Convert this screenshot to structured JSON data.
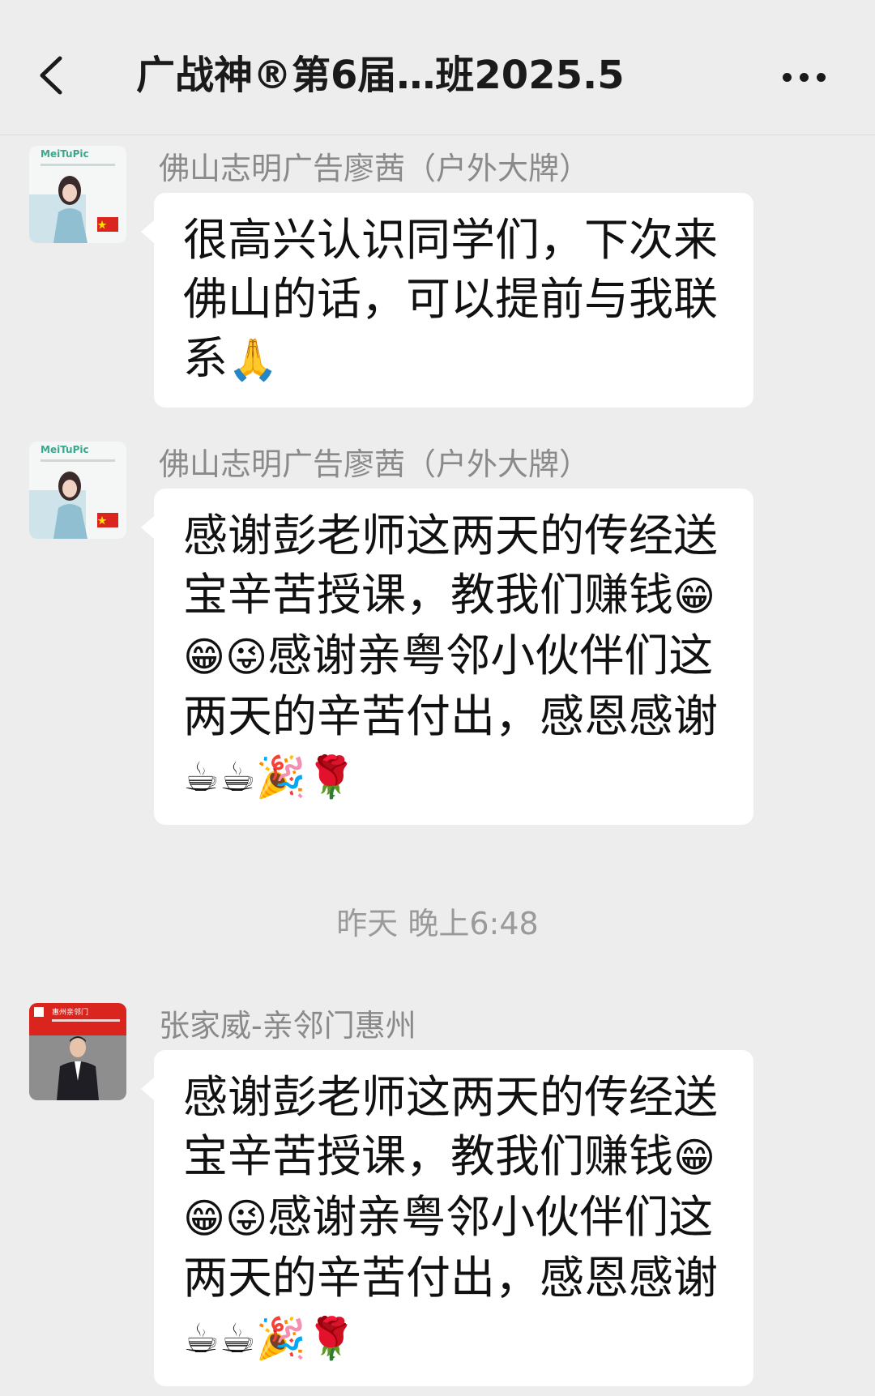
{
  "header": {
    "title": "广战神®第6届…班2025.5",
    "back_icon": "chevron-left-icon",
    "more_icon": "more-horizontal-icon"
  },
  "messages": [
    {
      "sender": "佛山志明广告廖茜（户外大牌）",
      "avatar_text": "MeiTuPic",
      "text": "很高兴认识同学们，下次来佛山的话，可以提前与我联系",
      "emojis": "🙏"
    },
    {
      "sender": "佛山志明广告廖茜（户外大牌）",
      "avatar_text": "MeiTuPic",
      "text_parts": [
        "感谢彭老师这两天的传经送宝辛苦授课，教我们赚钱",
        "😁😁😜",
        "感谢亲粤邻小伙伴们这两天的辛苦付出，感恩感谢",
        "☕☕🎉🌹"
      ]
    },
    {
      "sender": "张家威-亲邻门惠州",
      "avatar_text": "惠州亲邻门",
      "text_parts": [
        "感谢彭老师这两天的传经送宝辛苦授课，教我们赚钱",
        "😁😁😜",
        "感谢亲粤邻小伙伴们这两天的辛苦付出，感恩感谢",
        "☕☕🎉🌹"
      ]
    }
  ],
  "timestamp": "昨天 晚上6:48",
  "colors": {
    "background": "#ededed",
    "bubble": "#ffffff",
    "sender_name": "#8a8a8a",
    "timestamp": "#9a9a9a",
    "avatar_red": "#d9251d"
  }
}
